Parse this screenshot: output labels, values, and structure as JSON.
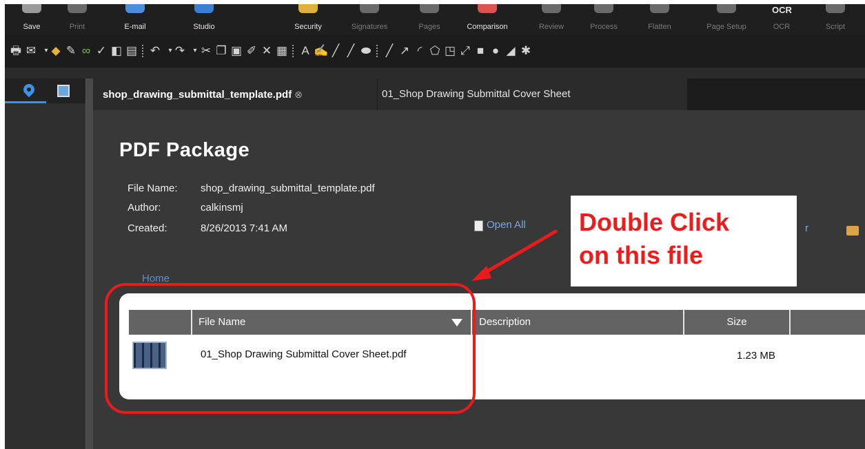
{
  "ribbon": {
    "buttons": [
      {
        "label": "Save",
        "enabled": true
      },
      {
        "label": "Print",
        "enabled": false
      },
      {
        "label": "E-mail",
        "enabled": true
      },
      {
        "label": "Studio",
        "enabled": true
      },
      {
        "label": "Security",
        "enabled": true
      },
      {
        "label": "Signatures",
        "enabled": false
      },
      {
        "label": "Pages",
        "enabled": false
      },
      {
        "label": "Comparison",
        "enabled": true
      },
      {
        "label": "Review",
        "enabled": false
      },
      {
        "label": "Process",
        "enabled": false
      },
      {
        "label": "Flatten",
        "enabled": false
      },
      {
        "label": "Page Setup",
        "enabled": false
      },
      {
        "label": "OCR",
        "enabled": false
      },
      {
        "label": "Script",
        "enabled": false
      }
    ],
    "ocr_glyph": "OCR"
  },
  "toolbar": {
    "icons": [
      "printer-icon",
      "email-icon",
      "package-icon",
      "edit-icon",
      "glasses-icon",
      "spellcheck-icon",
      "ocr-icon",
      "page-icon",
      "undo-icon",
      "redo-icon",
      "cut-icon",
      "copy-icon",
      "paste-icon",
      "brush-icon",
      "delete-icon",
      "stamp-icon",
      "text-icon",
      "pen-icon",
      "pencil-icon",
      "highlighter-icon",
      "eraser-icon",
      "line-icon",
      "arrow-icon",
      "arc-icon",
      "polygon-icon",
      "callout-icon",
      "dimension-icon",
      "rectangle-icon",
      "ellipse-icon",
      "shape-icon",
      "gear-icon"
    ]
  },
  "tabs": {
    "active": "shop_drawing_submittal_template.pdf",
    "close_glyph": "⊗",
    "second": "01_Shop Drawing Submittal Cover Sheet"
  },
  "package": {
    "title": "PDF Package",
    "file_name_label": "File Name:",
    "file_name": "shop_drawing_submittal_template.pdf",
    "author_label": "Author:",
    "author": "calkinsmj",
    "created_label": "Created:",
    "created": "8/26/2013 7:41 AM",
    "open_all": "Open All",
    "partial_link": "r",
    "home": "Home"
  },
  "table": {
    "columns": [
      "File Name",
      "Description",
      "Size"
    ],
    "rows": [
      {
        "file_name": "01_Shop Drawing Submittal Cover Sheet.pdf",
        "description": "",
        "size": "1.23 MB"
      }
    ]
  },
  "annotation": {
    "line1": "Double Click",
    "line2": "on this file",
    "color": "#ee1b1b"
  }
}
